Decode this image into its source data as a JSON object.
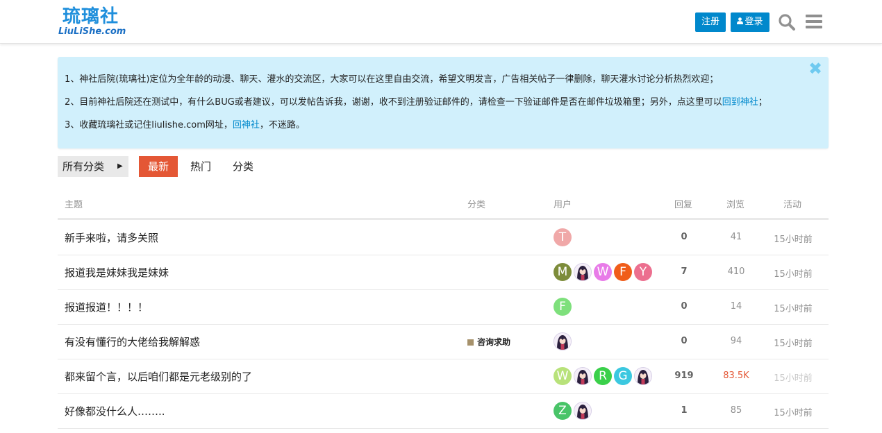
{
  "header": {
    "logo_cn": "琉璃社",
    "logo_en": "LiuLiShe.com",
    "signup_label": "注册",
    "login_label": "登录"
  },
  "notice": {
    "line1": "1、神社后院(琉璃社)定位为全年龄的动漫、聊天、灌水的交流区，大家可以在这里自由交流，希望文明发言，广告相关帖子一律删除，聊天灌水讨论分析热烈欢迎；",
    "line2_text": "2、目前神社后院还在测试中，有什么BUG或者建议，可以发帖告诉我，谢谢，收不到注册验证邮件的，请检查一下验证邮件是否在邮件垃圾箱里；另外，点这里可以",
    "line2_link": "回到神社",
    "line2_end": "；",
    "line3_text": "3、收藏琉璃社或记住liulishe.com网址，",
    "line3_link": "回神社",
    "line3_end": "，不迷路。",
    "close_glyph": "✖"
  },
  "nav": {
    "dropdown_label": "所有分类",
    "tabs": [
      "最新",
      "热门",
      "分类"
    ],
    "active_tab": "最新"
  },
  "table": {
    "headers": {
      "topic": "主题",
      "category": "分类",
      "users": "用户",
      "replies": "回复",
      "views": "浏览",
      "activity": "活动"
    },
    "rows": [
      {
        "title": "新手来啦，请多关照",
        "category": "",
        "avatars": [
          {
            "letter": "T",
            "color": "#f0a8a8"
          }
        ],
        "replies": "0",
        "views": "41",
        "activity": "15小时前"
      },
      {
        "title": "报道我是妹妹我是妹妹",
        "category": "",
        "avatars": [
          {
            "letter": "M",
            "color": "#7d8c3a"
          },
          {
            "letter": "",
            "color": "image"
          },
          {
            "letter": "W",
            "color": "#e87be8"
          },
          {
            "letter": "F",
            "color": "#f05d1a"
          },
          {
            "letter": "Y",
            "color": "#ec6f8f"
          }
        ],
        "replies": "7",
        "views": "410",
        "activity": "15小时前"
      },
      {
        "title": "报道报道！！！！",
        "category": "",
        "avatars": [
          {
            "letter": "F",
            "color": "#7ee07c"
          }
        ],
        "replies": "0",
        "views": "14",
        "activity": "15小时前"
      },
      {
        "title": "有没有懂行的大佬给我解解惑",
        "category": "咨询求助",
        "avatars": [
          {
            "letter": "",
            "color": "image"
          }
        ],
        "replies": "0",
        "views": "94",
        "activity": "15小时前"
      },
      {
        "title": "都来留个言，以后咱们都是元老级别的了",
        "category": "",
        "avatars": [
          {
            "letter": "W",
            "color": "#b8e27a"
          },
          {
            "letter": "",
            "color": "image"
          },
          {
            "letter": "R",
            "color": "#3ad04a"
          },
          {
            "letter": "G",
            "color": "#3bc8e0"
          },
          {
            "letter": "",
            "color": "image"
          }
        ],
        "replies": "919",
        "views": "83.5K",
        "activity": "15小时前"
      },
      {
        "title": "好像都没什么人……..",
        "category": "",
        "avatars": [
          {
            "letter": "Z",
            "color": "#49c468"
          },
          {
            "letter": "",
            "color": "image"
          }
        ],
        "replies": "1",
        "views": "85",
        "activity": "15小时前"
      }
    ]
  },
  "colors": {
    "accent": "#0088cc",
    "active_tab": "#e45735",
    "notice_bg": "#d1f0fc",
    "category_badge": "#a6916b"
  }
}
